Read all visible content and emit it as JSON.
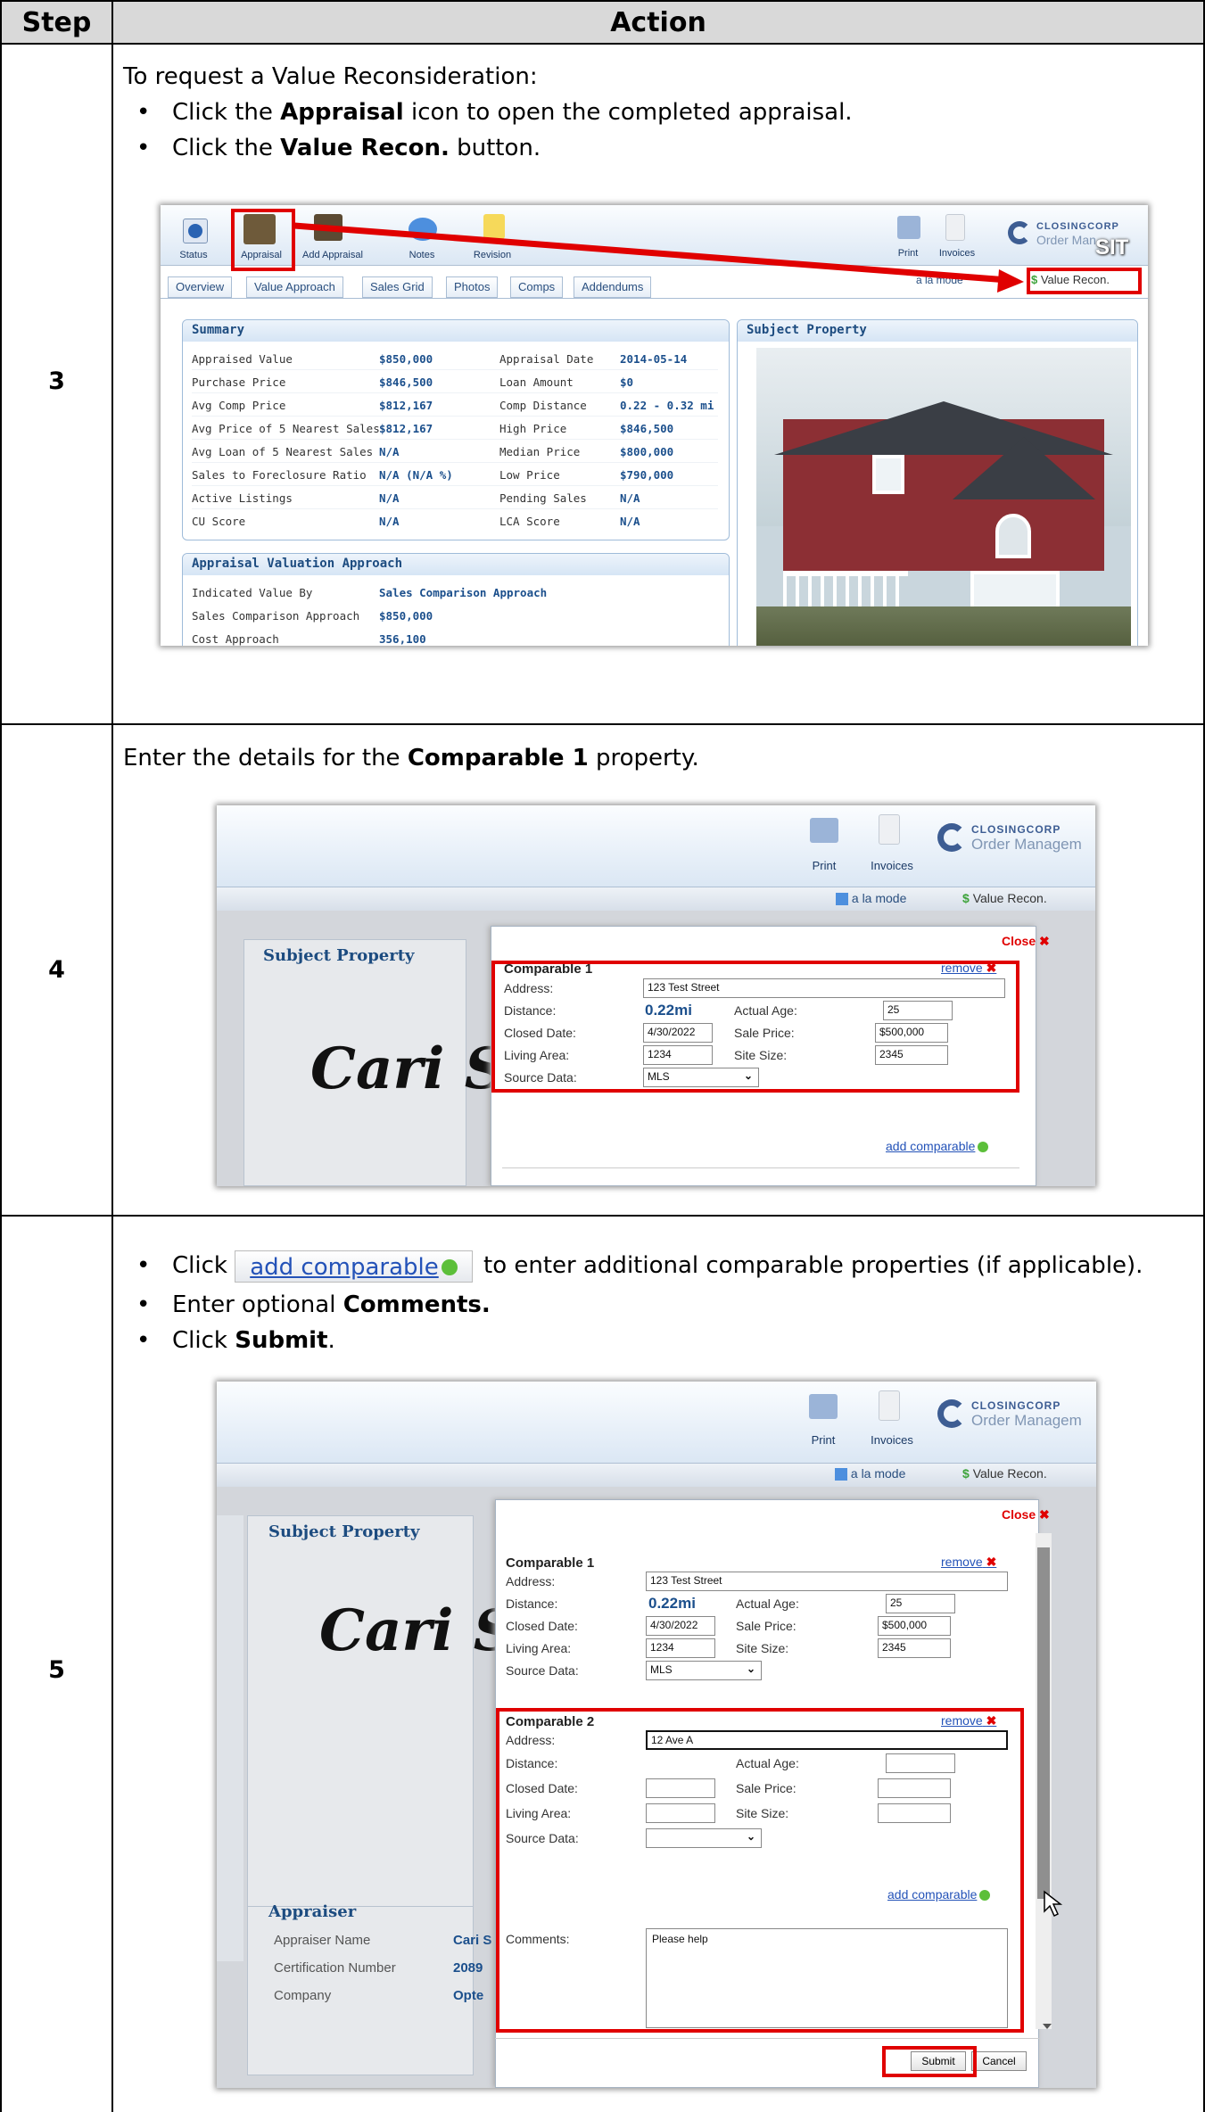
{
  "table": {
    "header_step": "Step",
    "header_action": "Action"
  },
  "step3": {
    "number": "3",
    "intro": "To request a Value Reconsideration:",
    "bullet1_pre": "Click the ",
    "bullet1_bold": "Appraisal",
    "bullet1_post": " icon to open the completed appraisal.",
    "bullet2_pre": "Click the ",
    "bullet2_bold": "Value Recon.",
    "bullet2_post": " button.",
    "toolbar": {
      "status": "Status",
      "appraisal": "Appraisal",
      "add_appraisal": "Add Appraisal",
      "notes": "Notes",
      "revision": "Revision",
      "print": "Print",
      "invoices": "Invoices",
      "brand_line1": "CLOSINGCORP",
      "brand_line2": "Order Man",
      "brand_badge": "SIT",
      "a_la_mode": "a la mode",
      "value_recon": "Value Recon."
    },
    "tabs": [
      "Overview",
      "Value Approach",
      "Sales Grid",
      "Photos",
      "Comps",
      "Addendums"
    ],
    "summary_title": "Summary",
    "summary_rows": [
      {
        "l1": "Appraised Value",
        "v1": "$850,000",
        "l2": "Appraisal Date",
        "v2": "2014-05-14"
      },
      {
        "l1": "Purchase Price",
        "v1": "$846,500",
        "l2": "Loan Amount",
        "v2": "$0"
      },
      {
        "l1": "Avg Comp Price",
        "v1": "$812,167",
        "l2": "Comp Distance",
        "v2": "0.22 - 0.32 mi"
      },
      {
        "l1": "Avg Price of 5 Nearest Sales",
        "v1": "$812,167",
        "l2": "High Price",
        "v2": "$846,500"
      },
      {
        "l1": "Avg Loan of 5 Nearest Sales",
        "v1": "N/A",
        "l2": "Median Price",
        "v2": "$800,000"
      },
      {
        "l1": "Sales to Foreclosure Ratio",
        "v1": "N/A (N/A %)",
        "l2": "Low Price",
        "v2": "$790,000"
      },
      {
        "l1": "Active Listings",
        "v1": "N/A",
        "l2": "Pending Sales",
        "v2": "N/A"
      },
      {
        "l1": "CU Score",
        "v1": "N/A",
        "l2": "LCA Score",
        "v2": "N/A"
      }
    ],
    "subject_title": "Subject Property",
    "valuation_title": "Appraisal Valuation Approach",
    "valuation_rows": [
      {
        "l": "Indicated Value By",
        "v": "Sales Comparison Approach"
      },
      {
        "l": "Sales Comparison Approach",
        "v": "$850,000"
      },
      {
        "l": "Cost Approach",
        "v": "356,100"
      }
    ]
  },
  "step4": {
    "number": "4",
    "text_pre": "Enter the details for the ",
    "text_bold": "Comparable 1",
    "text_post": " property.",
    "print": "Print",
    "invoices": "Invoices",
    "brand_line1": "CLOSINGCORP",
    "brand_line2": "Order Managem",
    "a_la_mode": "a la mode",
    "value_recon": "Value Recon.",
    "subject_title": "Subject Property",
    "signature": "Cari S.",
    "close": "Close",
    "comp_title": "Comparable 1",
    "remove": "remove",
    "address_label": "Address:",
    "address_value": "123 Test Street",
    "distance_label": "Distance:",
    "distance_value": "0.22mi",
    "actual_age_label": "Actual Age:",
    "actual_age_value": "25",
    "closed_date_label": "Closed Date:",
    "closed_date_value": "4/30/2022",
    "sale_price_label": "Sale Price:",
    "sale_price_value": "$500,000",
    "living_area_label": "Living Area:",
    "living_area_value": "1234",
    "site_size_label": "Site Size:",
    "site_size_value": "2345",
    "source_data_label": "Source Data:",
    "source_data_value": "MLS",
    "add_comparable": "add comparable"
  },
  "step5": {
    "number": "5",
    "bullet1_pre": "Click ",
    "bullet1_link": "add comparable",
    "bullet1_post": " to enter additional comparable properties (if applicable).",
    "bullet2_pre": "Enter optional ",
    "bullet2_bold": "Comments.",
    "bullet3_pre": "Click ",
    "bullet3_bold": "Submit",
    "bullet3_post": ".",
    "print": "Print",
    "invoices": "Invoices",
    "brand_line1": "CLOSINGCORP",
    "brand_line2": "Order Managem",
    "a_la_mode": "a la mode",
    "value_recon": "Value Recon.",
    "subject_title": "Subject Property",
    "signature": "Cari S.",
    "close": "Close",
    "comp1": {
      "title": "Comparable 1",
      "remove": "remove",
      "address": "123 Test Street",
      "distance": "0.22mi",
      "actual_age": "25",
      "closed_date": "4/30/2022",
      "sale_price": "$500,000",
      "living_area": "1234",
      "site_size": "2345",
      "source_data": "MLS"
    },
    "comp2": {
      "title": "Comparable 2",
      "remove": "remove",
      "address": "12 Ave A"
    },
    "labels": {
      "address": "Address:",
      "distance": "Distance:",
      "actual_age": "Actual Age:",
      "closed_date": "Closed Date:",
      "sale_price": "Sale Price:",
      "living_area": "Living Area:",
      "site_size": "Site Size:",
      "source_data": "Source Data:"
    },
    "add_comparable": "add comparable",
    "comments_label": "Comments:",
    "comments_value": "Please help",
    "appraiser_title": "Appraiser",
    "appraiser_name_label": "Appraiser Name",
    "appraiser_name_value": "Cari S",
    "cert_label": "Certification Number",
    "cert_value": "2089",
    "company_label": "Company",
    "company_value": "Opte",
    "submit": "Submit",
    "cancel": "Cancel"
  },
  "colors": {
    "highlight_red": "#e00000",
    "link_blue": "#2352b8",
    "header_gray": "#d9d9d9",
    "value_blue": "#1b4f8c"
  }
}
